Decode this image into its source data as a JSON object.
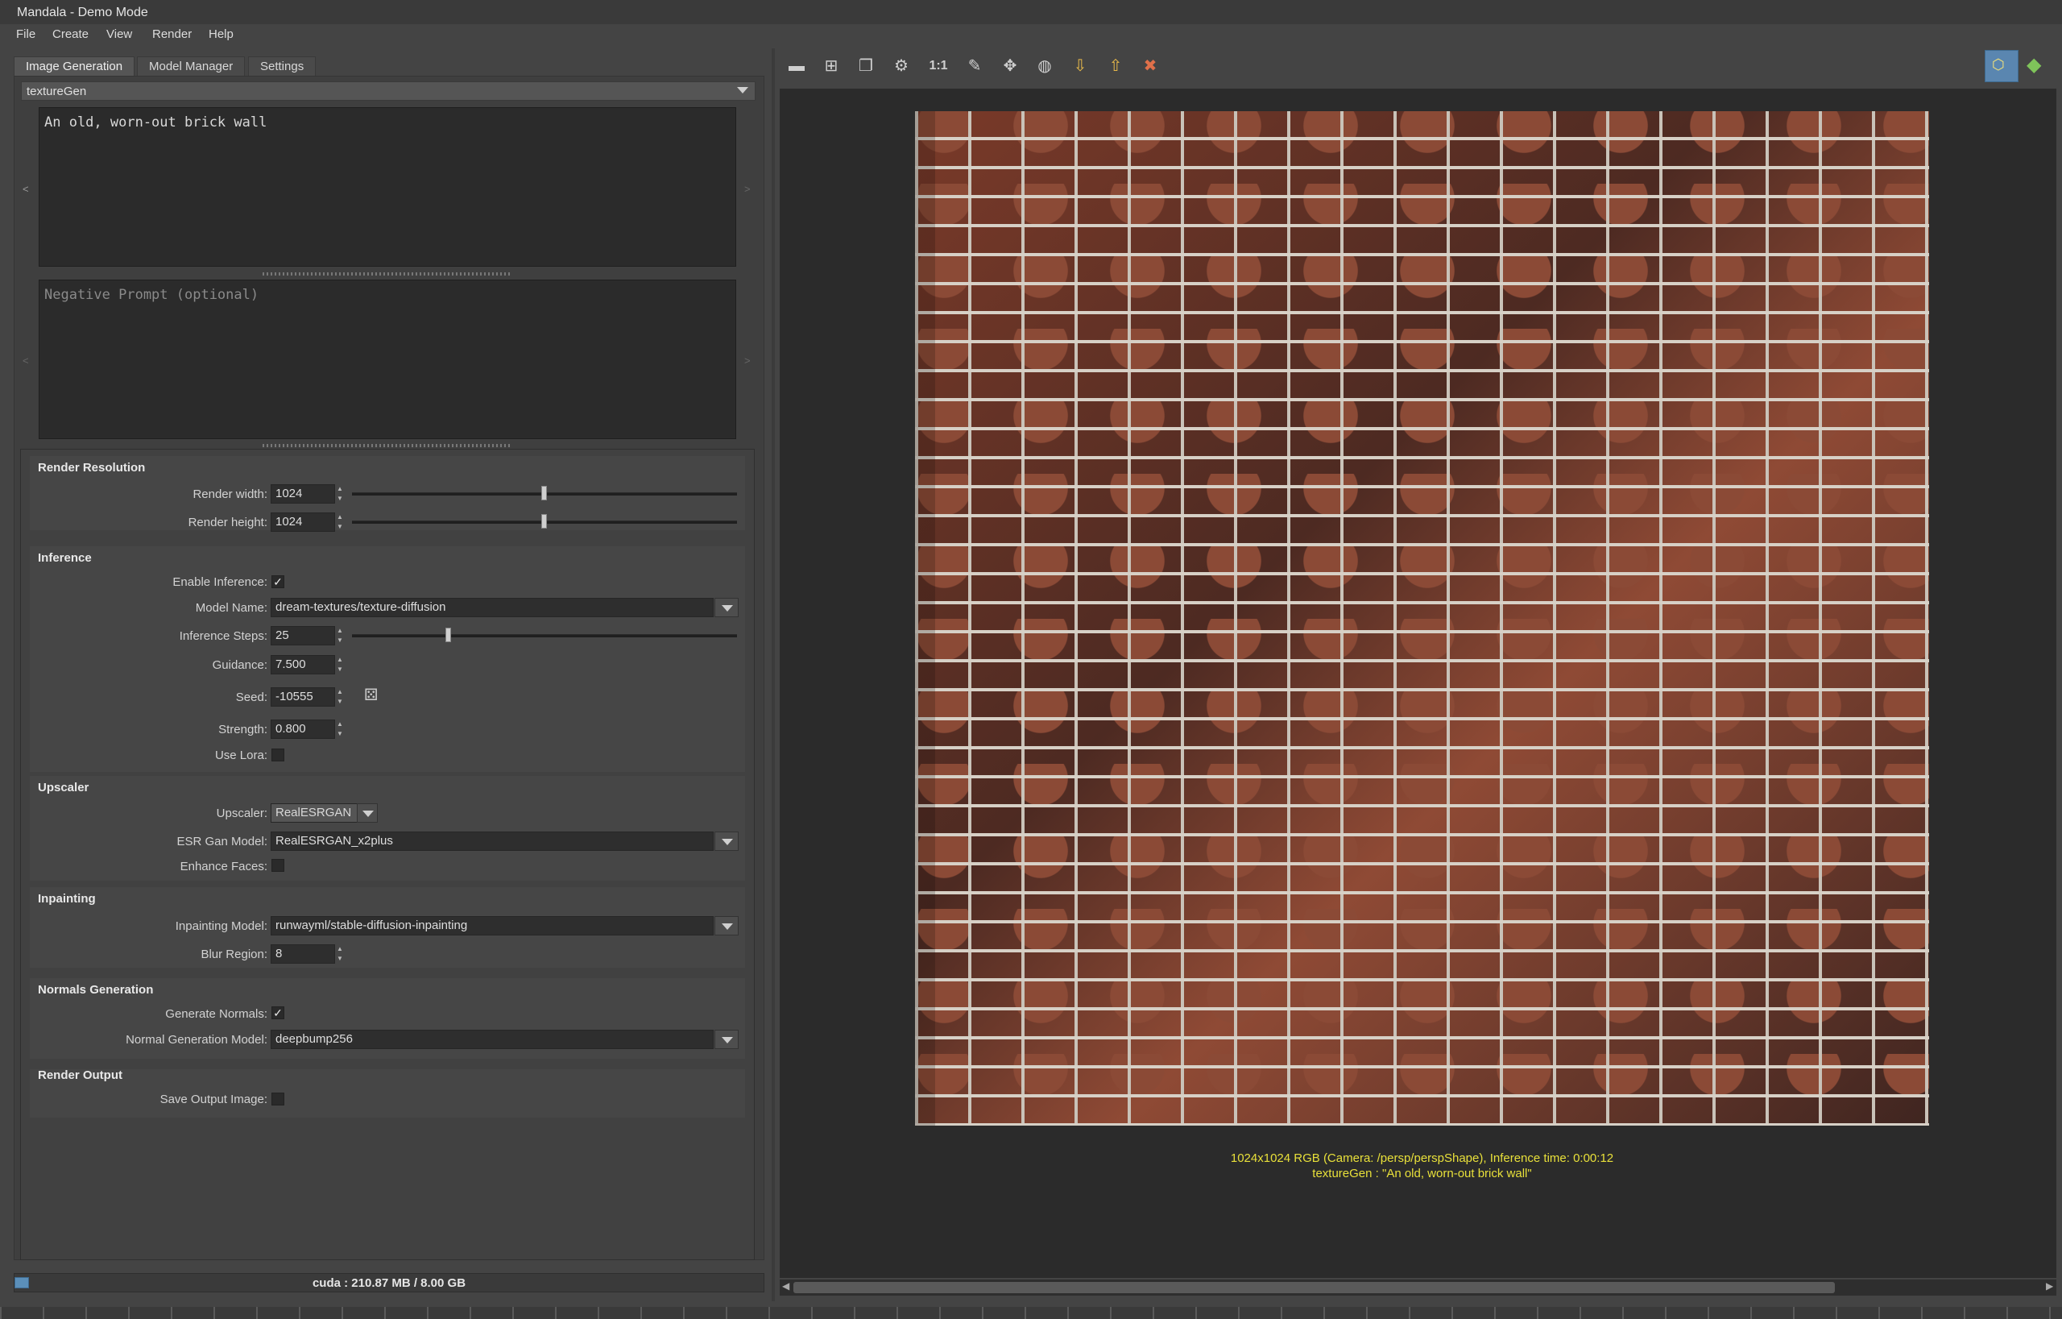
{
  "window": {
    "title": "Mandala - Demo Mode"
  },
  "menu": [
    "File",
    "Create",
    "View",
    "Render",
    "Help"
  ],
  "tabs": [
    "Image Generation",
    "Model Manager",
    "Settings"
  ],
  "preset": "textureGen",
  "prompt": {
    "value": "An old, worn-out brick wall",
    "negative_placeholder": "Negative Prompt (optional)"
  },
  "sections": {
    "render_resolution": {
      "title": "Render Resolution",
      "width_label": "Render width:",
      "width_value": "1024",
      "width_slider_fraction": 0.5,
      "height_label": "Render height:",
      "height_value": "1024",
      "height_slider_fraction": 0.5
    },
    "inference": {
      "title": "Inference",
      "enable_label": "Enable Inference:",
      "enable_checked": true,
      "model_label": "Model Name:",
      "model_value": "dream-textures/texture-diffusion",
      "steps_label": "Inference Steps:",
      "steps_value": "25",
      "steps_slider_fraction": 0.25,
      "guidance_label": "Guidance:",
      "guidance_value": "7.500",
      "seed_label": "Seed:",
      "seed_value": "-10555",
      "strength_label": "Strength:",
      "strength_value": "0.800",
      "lora_label": "Use Lora:",
      "lora_checked": false
    },
    "upscaler": {
      "title": "Upscaler",
      "upscaler_label": "Upscaler:",
      "upscaler_value": "RealESRGAN",
      "esr_label": "ESR Gan Model:",
      "esr_value": "RealESRGAN_x2plus",
      "faces_label": "Enhance Faces:",
      "faces_checked": false
    },
    "inpainting": {
      "title": "Inpainting",
      "model_label": "Inpainting Model:",
      "model_value": "runwayml/stable-diffusion-inpainting",
      "blur_label": "Blur Region:",
      "blur_value": "8"
    },
    "normals": {
      "title": "Normals Generation",
      "generate_label": "Generate Normals:",
      "generate_checked": true,
      "model_label": "Normal Generation Model:",
      "model_value": "deepbump256"
    },
    "output": {
      "title": "Render Output",
      "save_label": "Save Output Image:",
      "save_checked": false
    }
  },
  "status": {
    "cuda": "cuda : 210.87 MB / 8.00 GB"
  },
  "toolbar": {
    "one_to_one": "1:1"
  },
  "viewer": {
    "caption_line1": "1024x1024 RGB (Camera: /persp/perspShape), Inference time: 0:00:12",
    "caption_line2": "textureGen : \"An old, worn-out brick wall\""
  },
  "colors": {
    "caption": "#e8e03a",
    "accent": "#5b8fb9",
    "background": "#444444"
  }
}
